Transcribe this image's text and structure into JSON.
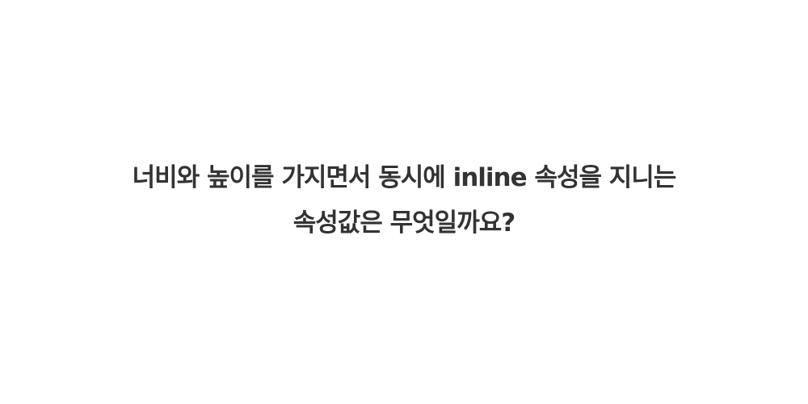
{
  "question": {
    "line1": "너비와 높이를 가지면서 동시에 inline 속성을 지니는",
    "line2": "속성값은 무엇일까요?"
  },
  "colors": {
    "background": "#ffffff",
    "text": "#333333"
  }
}
